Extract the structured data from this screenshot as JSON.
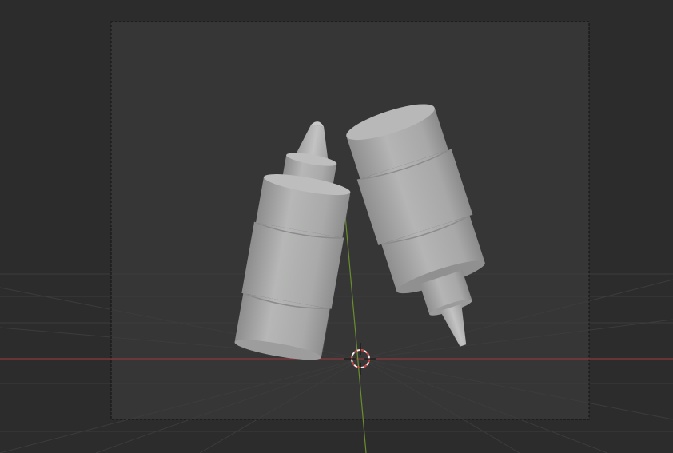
{
  "viewport": {
    "mode": "camera-view",
    "objects": [
      {
        "name": "bottle-left",
        "type": "mesh",
        "shading": "solid"
      },
      {
        "name": "bottle-right",
        "type": "mesh",
        "shading": "solid"
      }
    ]
  },
  "colors": {
    "background": "#2c2c2c",
    "camera_frame_fill": "#363636",
    "grid": "#3b3b3b",
    "x_axis": "#8a3a40",
    "y_axis": "#6a8e2e",
    "cursor_red": "#d23c3c",
    "cursor_white": "#f0f0f0",
    "mesh_light": "#b7b8b7",
    "mesh_mid": "#a6a7a6",
    "mesh_dark": "#7f807f"
  }
}
